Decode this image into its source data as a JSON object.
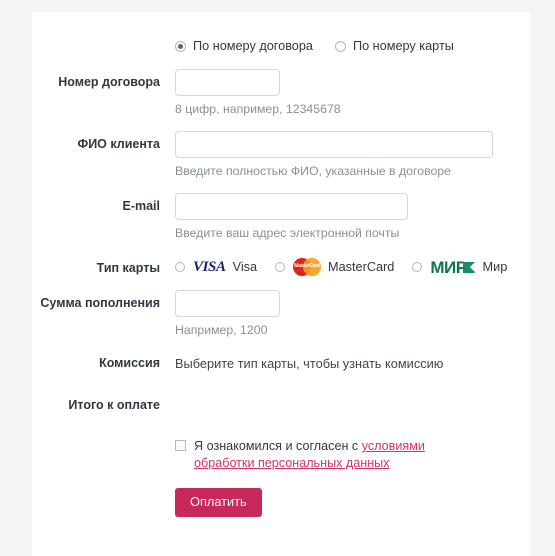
{
  "form": {
    "search_mode": {
      "options": [
        {
          "label": "По номеру договора",
          "selected": true
        },
        {
          "label": "По номеру карты",
          "selected": false
        }
      ]
    },
    "contract_number": {
      "label": "Номер договора",
      "value": "",
      "placeholder": "",
      "hint": "8 цифр, например, 12345678"
    },
    "client_name": {
      "label": "ФИО клиента",
      "value": "",
      "placeholder": "",
      "hint": "Введите полностью ФИО, указанные в договоре"
    },
    "email": {
      "label": "E-mail",
      "value": "",
      "placeholder": "",
      "hint": "Введите ваш адрес электронной почты"
    },
    "card_type": {
      "label": "Тип карты",
      "options": [
        {
          "name": "Visa",
          "logo": "visa-logo",
          "selected": false
        },
        {
          "name": "MasterCard",
          "logo": "mastercard-logo",
          "mark": "MasterCard",
          "selected": false
        },
        {
          "name": "Мир",
          "logo": "mir-logo",
          "mark": "МИР",
          "selected": false
        }
      ]
    },
    "amount": {
      "label": "Сумма пополнения",
      "value": "",
      "placeholder": "",
      "hint": "Например, 1200"
    },
    "commission": {
      "label": "Комиссия",
      "text": "Выберите тип карты, чтобы узнать комиссию"
    },
    "total": {
      "label": "Итого к оплате",
      "text": ""
    },
    "agreement": {
      "checked": false,
      "text_before": "Я ознакомился и согласен с ",
      "link_text": "условиями обработки персональных данных"
    },
    "submit": {
      "label": "Оплатить"
    }
  },
  "colors": {
    "page_background": "#f5f5f6",
    "card_background": "#ffffff",
    "accent": "#c9285a",
    "link": "#d6336c",
    "label_text": "#333741",
    "hint_text": "#8a8f98",
    "visa_blue": "#1a1f71",
    "mastercard_red": "#e2231a",
    "mastercard_orange": "#f79e1b",
    "mir_green": "#0f754e"
  }
}
